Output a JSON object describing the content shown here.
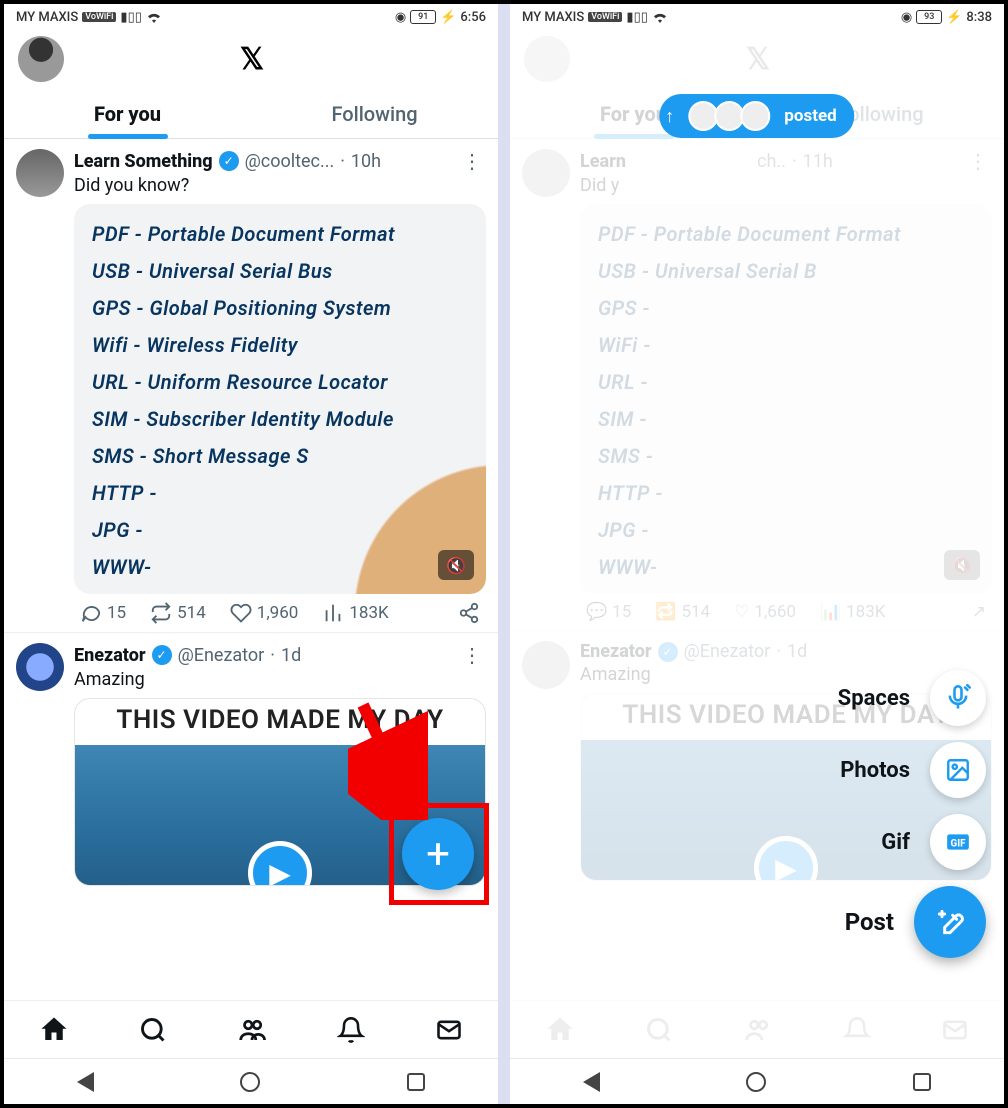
{
  "left": {
    "statusbar": {
      "carrier": "MY MAXIS",
      "wifi_badge": "VoWiFi",
      "battery_text": "91",
      "time": "6:56"
    },
    "tabs": {
      "for_you": "For you",
      "following": "Following"
    },
    "post1": {
      "name": "Learn Something",
      "handle": "@cooltec...",
      "time": "10h",
      "body": "Did you know?",
      "note_lines": [
        "PDF - Portable Document Format",
        "USB - Universal Serial Bus",
        "GPS - Global Positioning System",
        "Wifi - Wireless Fidelity",
        "URL - Uniform Resource Locator",
        "SIM - Subscriber Identity Module",
        "SMS - Short Message S",
        "HTTP -",
        "JPG -",
        "WWW-"
      ],
      "replies": "15",
      "reposts": "514",
      "likes": "1,960",
      "views": "183K"
    },
    "post2": {
      "name": "Enezator",
      "handle": "@Enezator",
      "time": "1d",
      "body": "Amazing",
      "video_title": "THIS VIDEO MADE MY DAY"
    },
    "fab_plus": "+"
  },
  "right": {
    "statusbar": {
      "carrier": "MY MAXIS",
      "wifi_badge": "VoWiFi",
      "battery_text": "93",
      "time": "8:38"
    },
    "tabs": {
      "for_you": "For you",
      "following": "Following"
    },
    "pill": {
      "arrow": "↑",
      "text": "posted"
    },
    "post1": {
      "name": "Learn",
      "handle": "ch..",
      "time": "11h",
      "body": "Did y",
      "note_lines": [
        "PDF - Portable Document Format",
        "USB - Universal Serial B",
        "GPS -",
        "WiFi -",
        "URL -",
        "SIM -",
        "SMS -",
        "HTTP -",
        "JPG -",
        "WWW-"
      ],
      "replies": "15",
      "reposts": "514",
      "likes": "1,660",
      "views": "183K"
    },
    "post2": {
      "name": "Enezator",
      "handle": "@Enezator",
      "time": "1d",
      "body": "Amazing",
      "video_title": "THIS VIDEO MADE MY DAY"
    },
    "fab_menu": {
      "spaces": "Spaces",
      "photos": "Photos",
      "gif": "Gif",
      "post": "Post"
    }
  }
}
